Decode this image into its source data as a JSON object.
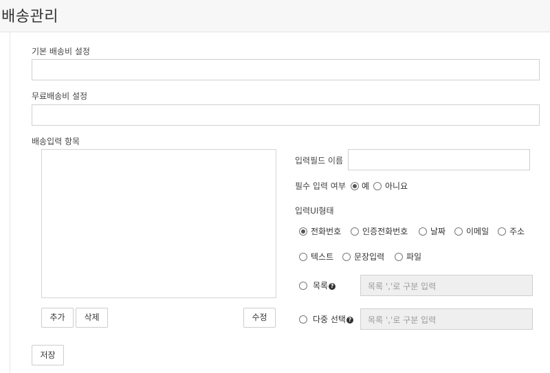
{
  "header": {
    "title": "배송관리"
  },
  "shipping_fee": {
    "label": "기본 배송비 설정",
    "value": ""
  },
  "free_shipping": {
    "label": "무료배송비 설정",
    "value": ""
  },
  "input_items": {
    "label": "배송입력 항목",
    "items": [],
    "buttons": {
      "add": "추가",
      "delete": "삭제",
      "edit": "수정"
    }
  },
  "field_name": {
    "label": "입력필드 이름",
    "value": ""
  },
  "required": {
    "label": "필수 입력 여부",
    "options": [
      {
        "label": "예",
        "checked": true
      },
      {
        "label": "아니요",
        "checked": false
      }
    ]
  },
  "ui_type": {
    "label": "입력UI형태",
    "row1": [
      {
        "label": "전화번호",
        "checked": true
      },
      {
        "label": "인증전화번호",
        "checked": false
      },
      {
        "label": "날짜",
        "checked": false
      },
      {
        "label": "이메일",
        "checked": false
      },
      {
        "label": "주소",
        "checked": false
      }
    ],
    "row2": [
      {
        "label": "텍스트",
        "checked": false
      },
      {
        "label": "문장입력",
        "checked": false
      },
      {
        "label": "파일",
        "checked": false
      }
    ],
    "list": {
      "label": "목록",
      "checked": false,
      "placeholder": "목록 ','로 구분 입력",
      "help_icon": "question-circle-icon"
    },
    "multi": {
      "label": "다중 선택",
      "checked": false,
      "placeholder": "목록 ','로 구분 입력",
      "help_icon": "question-circle-icon"
    }
  },
  "save_label": "저장"
}
